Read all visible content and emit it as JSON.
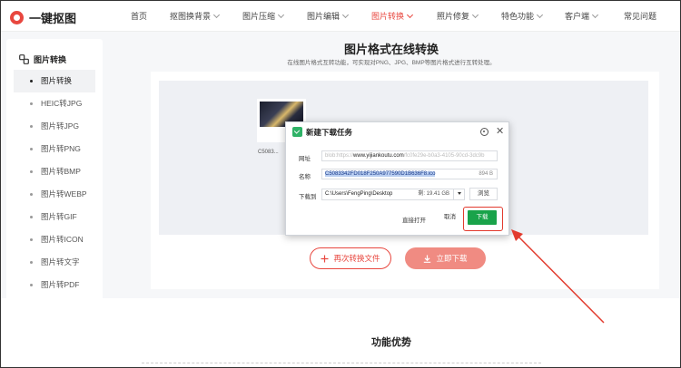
{
  "brand": {
    "name": "一键抠图",
    "accent": "#e8473f"
  },
  "nav": {
    "items": [
      {
        "label": "首页",
        "dropdown": false,
        "active": false
      },
      {
        "label": "抠图换背景",
        "dropdown": true,
        "active": false
      },
      {
        "label": "图片压缩",
        "dropdown": true,
        "active": false
      },
      {
        "label": "图片编辑",
        "dropdown": true,
        "active": false
      },
      {
        "label": "图片转换",
        "dropdown": true,
        "active": true
      },
      {
        "label": "照片修复",
        "dropdown": true,
        "active": false
      },
      {
        "label": "特色功能",
        "dropdown": true,
        "active": false
      },
      {
        "label": "客户端",
        "dropdown": true,
        "active": false
      },
      {
        "label": "常见问题",
        "dropdown": false,
        "active": false
      }
    ]
  },
  "sidebar": {
    "title": "图片转换",
    "items": [
      {
        "label": "图片转换",
        "active": true
      },
      {
        "label": "HEIC转JPG",
        "active": false
      },
      {
        "label": "图片转JPG",
        "active": false
      },
      {
        "label": "图片转PNG",
        "active": false
      },
      {
        "label": "图片转BMP",
        "active": false
      },
      {
        "label": "图片转WEBP",
        "active": false
      },
      {
        "label": "图片转GIF",
        "active": false
      },
      {
        "label": "图片转ICON",
        "active": false
      },
      {
        "label": "图片转文字",
        "active": false
      },
      {
        "label": "图片转PDF",
        "active": false
      }
    ]
  },
  "main": {
    "title": "图片格式在线转换",
    "subtitle": "在线图片格式互转功能，可实现对PNG、JPG、BMP等图片格式进行互转处理。",
    "thumb_name": "C5083...",
    "again_button": "再次转换文件",
    "download_button": "立即下载"
  },
  "features": {
    "title": "功能优势"
  },
  "dialog": {
    "title": "新建下载任务",
    "url_label": "网址",
    "url_prefix": "blob:https://",
    "url_domain": "www.yijiankoutu.com",
    "url_rest": "/fc0fe29e-b0a3-4105-90cd-3dc9b",
    "name_label": "名称",
    "file_name": "C5083342FD018F250A977590D1B636F8.ico",
    "file_size": "894 B",
    "saveto_label": "下载到",
    "path": "C:\\Users\\FengPing\\Desktop",
    "free_space": "剩: 19.41 GB",
    "browse_button": "浏览",
    "open_link": "直接打开",
    "cancel_button": "取消",
    "download_button": "下载"
  },
  "colors": {
    "highlight": "#e23b2e",
    "download_green": "#19a34a"
  }
}
